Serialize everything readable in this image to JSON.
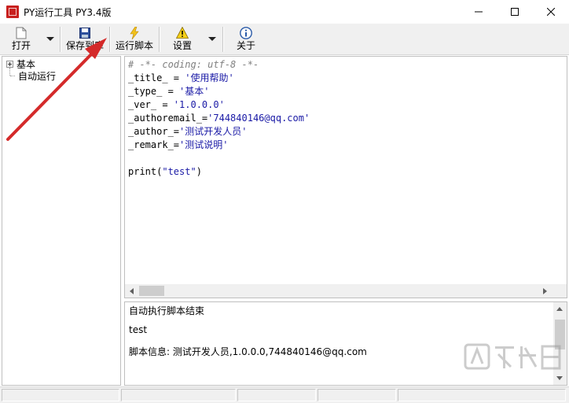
{
  "window": {
    "title": "PY运行工具 PY3.4版",
    "minimize_glyph": "—",
    "maximize_glyph": "☐",
    "close_glyph": "✕"
  },
  "toolbar": {
    "open_label": "打开",
    "save_to_lib_label": "保存到库",
    "run_script_label": "运行脚本",
    "settings_label": "设置",
    "about_label": "关于"
  },
  "tree": {
    "items": [
      {
        "label": "基本",
        "expandable": true
      },
      {
        "label": "自动运行",
        "expandable": false
      }
    ]
  },
  "editor": {
    "lines": [
      {
        "segments": [
          {
            "text": "# -*- coding: utf-8 -*-",
            "kind": "comment"
          }
        ]
      },
      {
        "segments": [
          {
            "text": "_title_ = ",
            "kind": "plain"
          },
          {
            "text": "'使用帮助'",
            "kind": "string"
          }
        ]
      },
      {
        "segments": [
          {
            "text": "_type_ = ",
            "kind": "plain"
          },
          {
            "text": "'基本'",
            "kind": "string"
          }
        ]
      },
      {
        "segments": [
          {
            "text": "_ver_ = ",
            "kind": "plain"
          },
          {
            "text": "'1.0.0.0'",
            "kind": "string"
          }
        ]
      },
      {
        "segments": [
          {
            "text": "_authoremail_=",
            "kind": "plain"
          },
          {
            "text": "'744840146@qq.com'",
            "kind": "string"
          }
        ]
      },
      {
        "segments": [
          {
            "text": "_author_=",
            "kind": "plain"
          },
          {
            "text": "'测试开发人员'",
            "kind": "string"
          }
        ]
      },
      {
        "segments": [
          {
            "text": "_remark_=",
            "kind": "plain"
          },
          {
            "text": "'测试说明'",
            "kind": "string"
          }
        ]
      },
      {
        "segments": [
          {
            "text": "",
            "kind": "plain"
          }
        ]
      },
      {
        "segments": [
          {
            "text": "print(",
            "kind": "plain"
          },
          {
            "text": "\"test\"",
            "kind": "string"
          },
          {
            "text": ")",
            "kind": "plain"
          }
        ]
      }
    ]
  },
  "output": {
    "line1": "自动执行脚本结束",
    "line2": "test",
    "line3": " 脚本信息: 测试开发人员,1.0.0.0,744840146@qq.com"
  },
  "colors": {
    "comment": "#808080",
    "string": "#1a1aa6",
    "annotation_arrow": "#d42a2a"
  }
}
